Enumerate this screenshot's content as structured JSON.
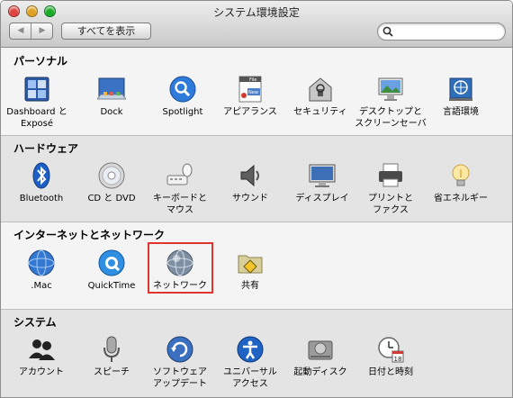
{
  "window": {
    "title": "システム環境設定",
    "show_all_label": "すべてを表示",
    "back_icon": "arrow-left-icon",
    "forward_icon": "arrow-right-icon",
    "search": {
      "value": "",
      "placeholder": ""
    }
  },
  "traffic_lights": {
    "close": "#e0443e",
    "minimize": "#dea123",
    "zoom": "#1aab29"
  },
  "highlight_color": "#e0352f",
  "sections": [
    {
      "title": "パーソナル",
      "items": [
        {
          "label": "Dashboard と\nExposé",
          "icon": "dashboard-expose-icon"
        },
        {
          "label": "Dock",
          "icon": "dock-icon"
        },
        {
          "label": "Spotlight",
          "icon": "spotlight-icon"
        },
        {
          "label": "アピアランス",
          "icon": "appearance-icon"
        },
        {
          "label": "セキュリティ",
          "icon": "security-icon"
        },
        {
          "label": "デスクトップと\nスクリーンセーバ",
          "icon": "desktop-screensaver-icon"
        },
        {
          "label": "言語環境",
          "icon": "international-icon"
        }
      ]
    },
    {
      "title": "ハードウェア",
      "items": [
        {
          "label": "Bluetooth",
          "icon": "bluetooth-icon"
        },
        {
          "label": "CD と DVD",
          "icon": "cd-dvd-icon"
        },
        {
          "label": "キーボードと\nマウス",
          "icon": "keyboard-mouse-icon"
        },
        {
          "label": "サウンド",
          "icon": "sound-icon"
        },
        {
          "label": "ディスプレイ",
          "icon": "displays-icon"
        },
        {
          "label": "プリントと\nファクス",
          "icon": "print-fax-icon"
        },
        {
          "label": "省エネルギー",
          "icon": "energy-saver-icon"
        }
      ]
    },
    {
      "title": "インターネットとネットワーク",
      "items": [
        {
          "label": ".Mac",
          "icon": "dotmac-icon"
        },
        {
          "label": "QuickTime",
          "icon": "quicktime-icon"
        },
        {
          "label": "ネットワーク",
          "icon": "network-icon",
          "selected": true
        },
        {
          "label": "共有",
          "icon": "sharing-icon"
        }
      ]
    },
    {
      "title": "システム",
      "items": [
        {
          "label": "アカウント",
          "icon": "accounts-icon"
        },
        {
          "label": "スピーチ",
          "icon": "speech-icon"
        },
        {
          "label": "ソフトウェア\nアップデート",
          "icon": "software-update-icon"
        },
        {
          "label": "ユニバーサル\nアクセス",
          "icon": "universal-access-icon"
        },
        {
          "label": "起動ディスク",
          "icon": "startup-disk-icon"
        },
        {
          "label": "日付と時刻",
          "icon": "date-time-icon"
        }
      ]
    }
  ],
  "icon_text": {
    "file": "File",
    "new": "New",
    "calendar_day": "18"
  }
}
